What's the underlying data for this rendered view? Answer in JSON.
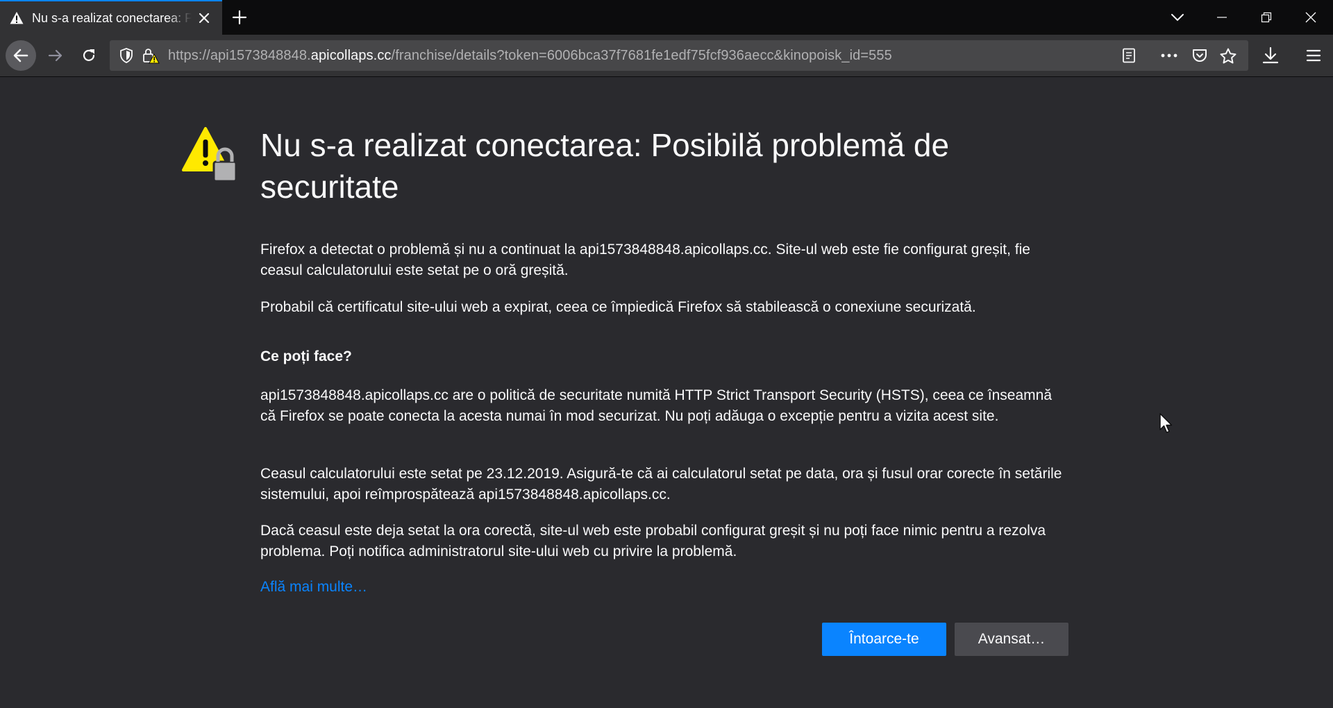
{
  "tab": {
    "title": "Nu s-a realizat conectarea: Posibilă problemă de securitate",
    "icon": "warning-icon"
  },
  "window_controls": [
    "minimize-icon",
    "restore-icon",
    "close-icon"
  ],
  "urlbar": {
    "url_prefix": "https://api1573848848.",
    "url_host": "apicollaps.cc",
    "url_suffix": "/franchise/details?token=6006bca37f7681fe1edf75fcf936aecc&kinopoisk_id=555"
  },
  "error": {
    "title": "Nu s-a realizat conectarea: Posibilă problemă de securitate",
    "p1": "Firefox a detectat o problemă și nu a continuat la api1573848848.apicollaps.cc. Site-ul web este fie configurat greșit, fie ceasul calculatorului este setat pe o oră greșită.",
    "p2": "Probabil că certificatul site-ului web a expirat, ceea ce împiedică Firefox să stabilească o conexiune securizată.",
    "what_heading": "Ce poți face?",
    "p3": "api1573848848.apicollaps.cc are o politică de securitate numită HTTP Strict Transport Security (HSTS), ceea ce înseamnă că Firefox se poate conecta la acesta numai în mod securizat. Nu poți adăuga o excepție pentru a vizita acest site.",
    "p4": "Ceasul calculatorului este setat pe 23.12.2019. Asigură-te că ai calculatorul setat pe data, ora și fusul orar corecte în setările sistemului, apoi reîmprospătează api1573848848.apicollaps.cc.",
    "p5": "Dacă ceasul este deja setat la ora corectă, site-ul web este probabil configurat greșit și nu poți face nimic pentru a rezolva problema. Poți notifica administratorul site-ului web cu privire la problemă.",
    "learn_more": "Află mai multe…",
    "go_back": "Întoarce-te",
    "advanced": "Avansat…"
  },
  "colors": {
    "accent": "#0a84ff",
    "warning": "#ffe900",
    "page_bg": "#2a2a2e",
    "toolbar_bg": "#323234",
    "tabstrip_bg": "#0c0c0d"
  }
}
